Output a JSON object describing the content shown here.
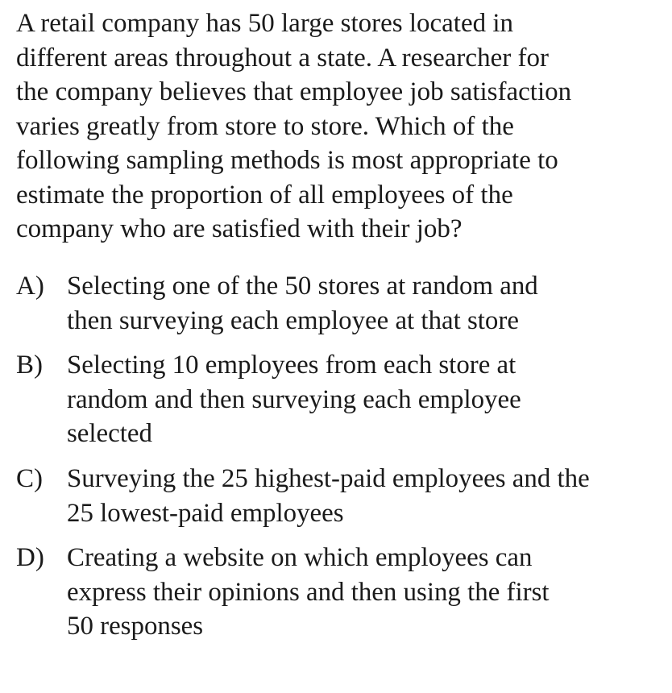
{
  "question": {
    "lines": [
      "A retail company has 50 large stores located in",
      "different areas throughout a state. A researcher for",
      "the company believes that employee job satisfaction",
      "varies greatly from store to store. Which of the",
      "following sampling methods is most appropriate to",
      "estimate the proportion of all employees of the",
      "company who are satisfied with their job?"
    ]
  },
  "choices": [
    {
      "letter": "A)",
      "lines": [
        "Selecting one of the 50 stores at random and",
        "then surveying each employee at that store"
      ]
    },
    {
      "letter": "B)",
      "lines": [
        "Selecting 10 employees from each store at",
        "random and then surveying each employee",
        "selected"
      ]
    },
    {
      "letter": "C)",
      "lines": [
        "Surveying the 25 highest-paid employees and the",
        "25 lowest-paid employees"
      ]
    },
    {
      "letter": "D)",
      "lines": [
        "Creating a website on which employees can",
        "express their opinions and then using the first",
        "50 responses"
      ]
    }
  ]
}
